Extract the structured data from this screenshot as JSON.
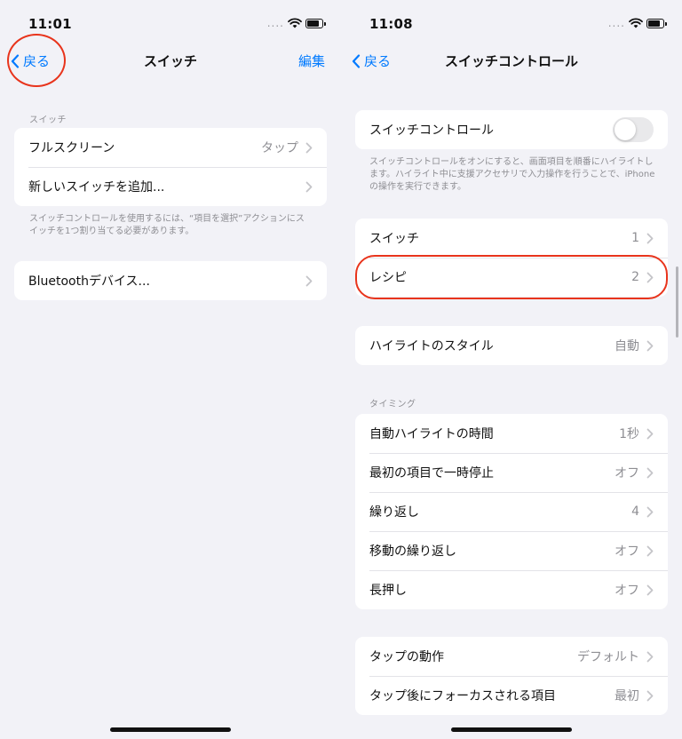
{
  "left": {
    "status": {
      "time": "11:01"
    },
    "nav": {
      "back": "戻る",
      "title": "スイッチ",
      "action": "編集"
    },
    "section_label": "スイッチ",
    "rows": [
      {
        "label": "フルスクリーン",
        "value": "タップ"
      },
      {
        "label": "新しいスイッチを追加..."
      }
    ],
    "footnote": "スイッチコントロールを使用するには、“項目を選択”アクションにスイッチを1つ割り当てる必要があります。",
    "bluetooth": {
      "label": "Bluetoothデバイス..."
    }
  },
  "right": {
    "status": {
      "time": "11:08"
    },
    "nav": {
      "back": "戻る",
      "title": "スイッチコントロール"
    },
    "main_toggle": {
      "label": "スイッチコントロール",
      "on": false
    },
    "toggle_footnote": "スイッチコントロールをオンにすると、画面項目を順番にハイライトします。ハイライト中に支援アクセサリで入力操作を行うことで、iPhoneの操作を実行できます。",
    "group1": [
      {
        "label": "スイッチ",
        "value": "1"
      },
      {
        "label": "レシピ",
        "value": "2"
      }
    ],
    "highlight_style": {
      "label": "ハイライトのスタイル",
      "value": "自動"
    },
    "timing_label": "タイミング",
    "timing": [
      {
        "label": "自動ハイライトの時間",
        "value": "1秒"
      },
      {
        "label": "最初の項目で一時停止",
        "value": "オフ"
      },
      {
        "label": "繰り返し",
        "value": "4"
      },
      {
        "label": "移動の繰り返し",
        "value": "オフ"
      },
      {
        "label": "長押し",
        "value": "オフ"
      }
    ],
    "tap": [
      {
        "label": "タップの動作",
        "value": "デフォルト"
      },
      {
        "label": "タップ後にフォーカスされる項目",
        "value": "最初"
      }
    ]
  },
  "colors": {
    "accent": "#007aff",
    "annotation": "#e8341c",
    "background": "#f2f2f7"
  }
}
